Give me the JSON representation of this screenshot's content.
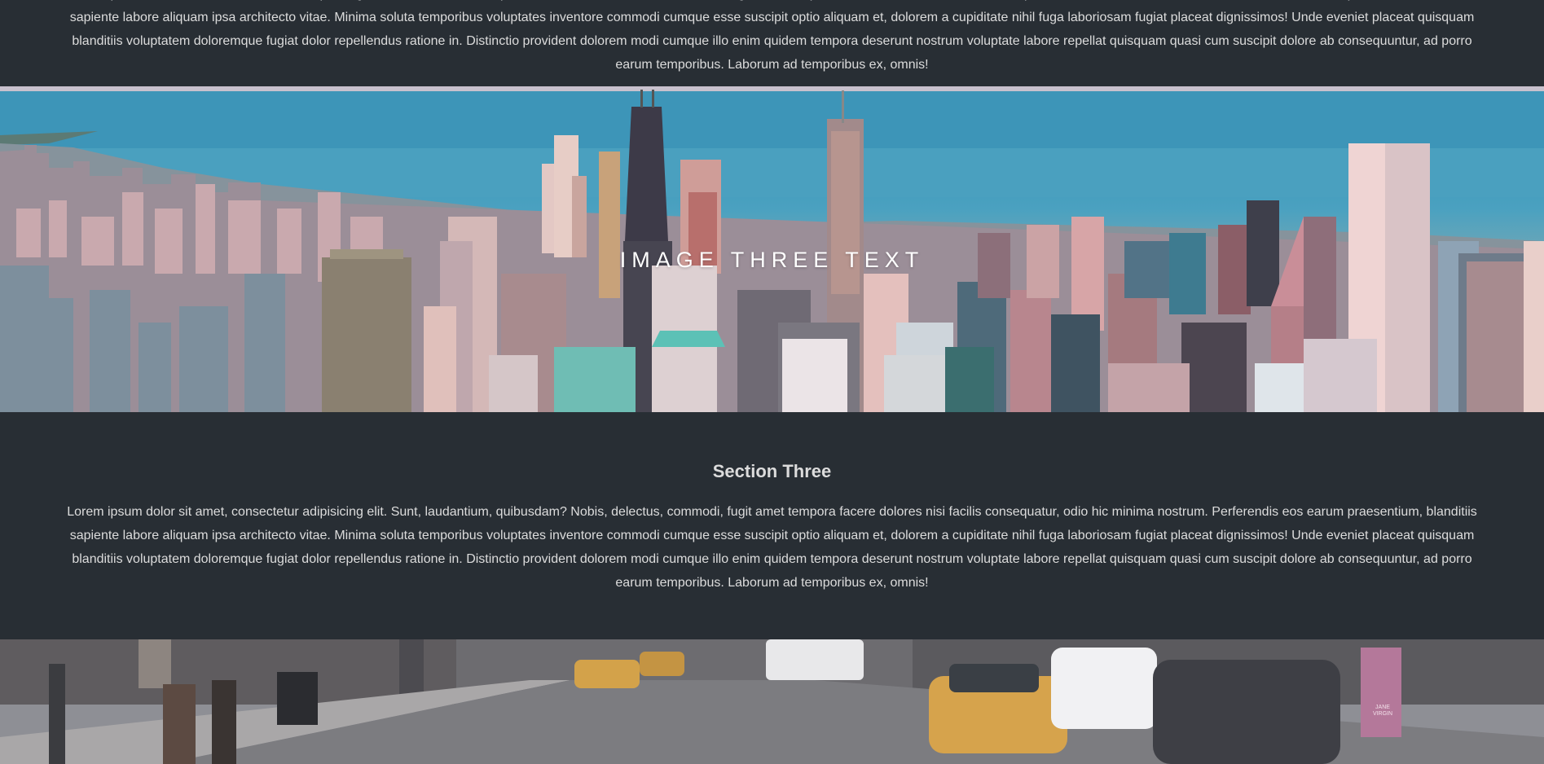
{
  "section_top": {
    "text": "Lorem ipsum dolor sit amet, consectetur adipisicing elit. Sunt, laudantium, quibusdam? Nobis, delectus, commodi, fugit amet tempora facere dolores nisi facilis consequatur, odio hic minima nostrum. Perferendis eos earum praesentium, blanditiis sapiente labore aliquam ipsa architecto vitae. Minima soluta temporibus voluptates inventore commodi cumque esse suscipit optio aliquam et, dolorem a cupiditate nihil fuga laboriosam fugiat placeat dignissimos! Unde eveniet placeat quisquam blanditiis voluptatem doloremque fugiat dolor repellendus ratione in. Distinctio provident dolorem modi cumque illo enim quidem tempora deserunt nostrum voluptate labore repellat quisquam quasi cum suscipit dolore ab consequuntur, ad porro earum temporibus. Laborum ad temporibus ex, omnis!"
  },
  "image_three": {
    "caption": "Image Three Text"
  },
  "section_three": {
    "heading": "Section Three",
    "text": "Lorem ipsum dolor sit amet, consectetur adipisicing elit. Sunt, laudantium, quibusdam? Nobis, delectus, commodi, fugit amet tempora facere dolores nisi facilis consequatur, odio hic minima nostrum. Perferendis eos earum praesentium, blanditiis sapiente labore aliquam ipsa architecto vitae. Minima soluta temporibus voluptates inventore commodi cumque esse suscipit optio aliquam et, dolorem a cupiditate nihil fuga laboriosam fugiat placeat dignissimos! Unde eveniet placeat quisquam blanditiis voluptatem doloremque fugiat dolor repellendus ratione in. Distinctio provident dolorem modi cumque illo enim quidem tempora deserunt nostrum voluptate labore repellat quisquam quasi cum suscipit dolore ab consequuntur, ad porro earum temporibus. Laborum ad temporibus ex, omnis!"
  },
  "image_four": {
    "sign_text": "JANE VIRGIN"
  },
  "colors": {
    "section_bg": "#282e34",
    "text": "#dcdcdc",
    "caption": "#ffffff"
  }
}
